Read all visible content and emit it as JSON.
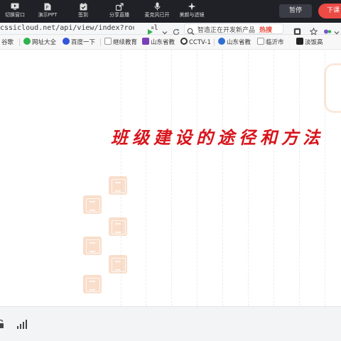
{
  "toolbar": {
    "items": [
      {
        "label": "切换窗口",
        "icon": "switch-window-icon"
      },
      {
        "label": "演示PPT",
        "icon": "ppt-icon"
      },
      {
        "label": "签到",
        "icon": "sign-in-icon"
      },
      {
        "label": "分享直播",
        "icon": "share-live-icon"
      },
      {
        "label": "麦克风已开",
        "icon": "microphone-icon"
      },
      {
        "label": "美颜与滤镜",
        "icon": "beauty-filter-icon"
      }
    ],
    "pause_label": "暂停",
    "end_label": "下课",
    "end_color": "#ec4a45"
  },
  "browser": {
    "url": "cssicloud.net/api/view/index?roomid=l",
    "search_text": "智造正在开发新产品",
    "search_hot": "热搜"
  },
  "bookmarks": [
    {
      "label": "谷歌",
      "color": "#3c7ef0"
    },
    {
      "label": "网址大全",
      "color": "#2fb34b"
    },
    {
      "label": "百度一下",
      "color": "#3154d9"
    },
    {
      "label": "继续教育",
      "color": "#8a8a8a"
    },
    {
      "label": "山东省教",
      "color": "#7b3fb8"
    },
    {
      "label": "CCTV-1",
      "color": "#222222"
    },
    {
      "label": "山东省教",
      "color": "#2f6fd1"
    },
    {
      "label": "临沂市",
      "color": "#8a8a8a"
    },
    {
      "label": "淡饭高",
      "color": "#222222"
    }
  ],
  "slide": {
    "title": "班级建设的途径和方法",
    "title_color": "#d8141b"
  },
  "status": {
    "icons": [
      "lock-icon",
      "signal-bars-icon"
    ]
  }
}
